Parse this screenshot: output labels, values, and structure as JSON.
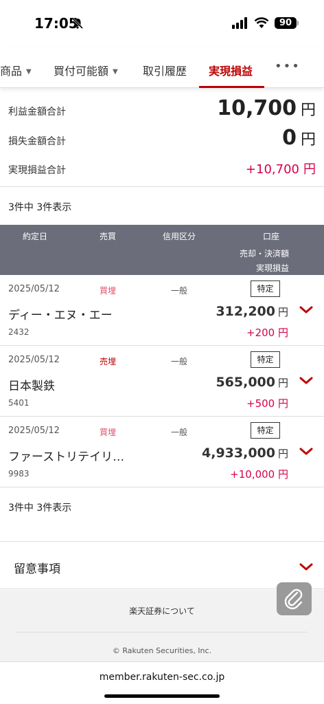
{
  "status": {
    "time": "17:05",
    "battery": "90"
  },
  "tabs": [
    {
      "label": "商品",
      "caret": "▼"
    },
    {
      "label": "買付可能額",
      "caret": "▼"
    },
    {
      "label": "取引履歴"
    },
    {
      "label": "実現損益"
    }
  ],
  "tabs_more": "•••",
  "summary": {
    "profit_label": "利益金額合計",
    "profit_value": "10,700",
    "loss_label": "損失金額合計",
    "loss_value": "0",
    "realized_label": "実現損益合計",
    "realized_value": "+10,700",
    "yen": "円"
  },
  "count_text": "3件中 3件表示",
  "table_header": {
    "date": "約定日",
    "trade": "売買",
    "margin": "信用区分",
    "account": "口座",
    "settle": "売却・決済額",
    "pnl": "実現損益"
  },
  "rows": [
    {
      "date": "2025/05/12",
      "trade": "買埋",
      "margin": "一般",
      "account": "特定",
      "name": "ディー・エヌ・エー",
      "code": "2432",
      "amount": "312,200",
      "pnl": "+200 円"
    },
    {
      "date": "2025/05/12",
      "trade": "売埋",
      "margin": "一般",
      "account": "特定",
      "name": "日本製鉄",
      "code": "5401",
      "amount": "565,000",
      "pnl": "+500 円"
    },
    {
      "date": "2025/05/12",
      "trade": "買埋",
      "margin": "一般",
      "account": "特定",
      "name": "ファーストリテイリ…",
      "code": "9983",
      "amount": "4,933,000",
      "pnl": "+10,000 円"
    }
  ],
  "notes_title": "留意事項",
  "footer": {
    "about": "楽天証券について",
    "copyright": "© Rakuten Securities, Inc."
  },
  "url": "member.rakuten-sec.co.jp",
  "colors": {
    "accent": "#bf0000",
    "positive": "#d6004c",
    "header_bg": "#6c6d7a"
  }
}
